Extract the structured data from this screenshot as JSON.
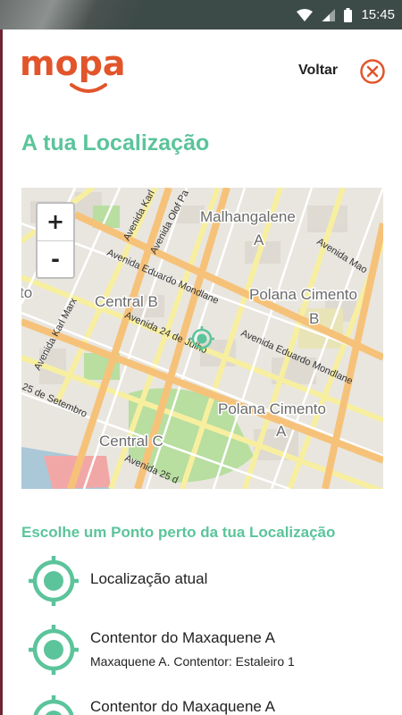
{
  "status_bar": {
    "time": "15:45",
    "icons": [
      "wifi-icon",
      "signal-icon",
      "battery-icon"
    ]
  },
  "header": {
    "logo_text": "mopa",
    "back_label": "Voltar",
    "close_icon": "close-icon"
  },
  "page_title": "A tua Localização",
  "map": {
    "zoom_in_label": "+",
    "zoom_out_label": "-",
    "labels": {
      "malhangalene": "Malhangalene",
      "malhangalene_sub": "A",
      "polana_b": "Polana Cimento",
      "polana_b_sub": "B",
      "central_b": "Central B",
      "polana_a": "Polana Cimento",
      "polana_a_sub": "A",
      "central_c": "Central C",
      "edge_to": "to"
    },
    "streets": {
      "eduardo_mondlane_1": "Avenida Eduardo Mondlane",
      "eduardo_mondlane_2": "Avenida Eduardo Mondlane",
      "vinte_quatro_julho": "Avenida 24 de Julho",
      "karl_marx": "Avenida Karl Marx",
      "karl": "Avenida Karl",
      "olof_pa": "Avenida Olof Pa",
      "mao": "Avenida Mao",
      "setembro": "25 de Setembro",
      "vinte_cinco": "Avenida 25 d"
    },
    "colors": {
      "main_road": "#f6c27a",
      "secondary_road": "#f7ef9f",
      "park": "#b8dea0",
      "marker": "#5bc49b"
    }
  },
  "list": {
    "heading": "Escolhe um Ponto perto da tua Localização",
    "items": [
      {
        "name": "Localização atual",
        "description": ""
      },
      {
        "name": "Contentor do Maxaquene A",
        "description": "Maxaquene A. Contentor: Estaleiro 1"
      },
      {
        "name": "Contentor do Maxaquene A",
        "description": ""
      }
    ]
  },
  "colors": {
    "brand": "#e2552b",
    "accent": "#5bc49b",
    "status_bar": "#3c4a48"
  }
}
